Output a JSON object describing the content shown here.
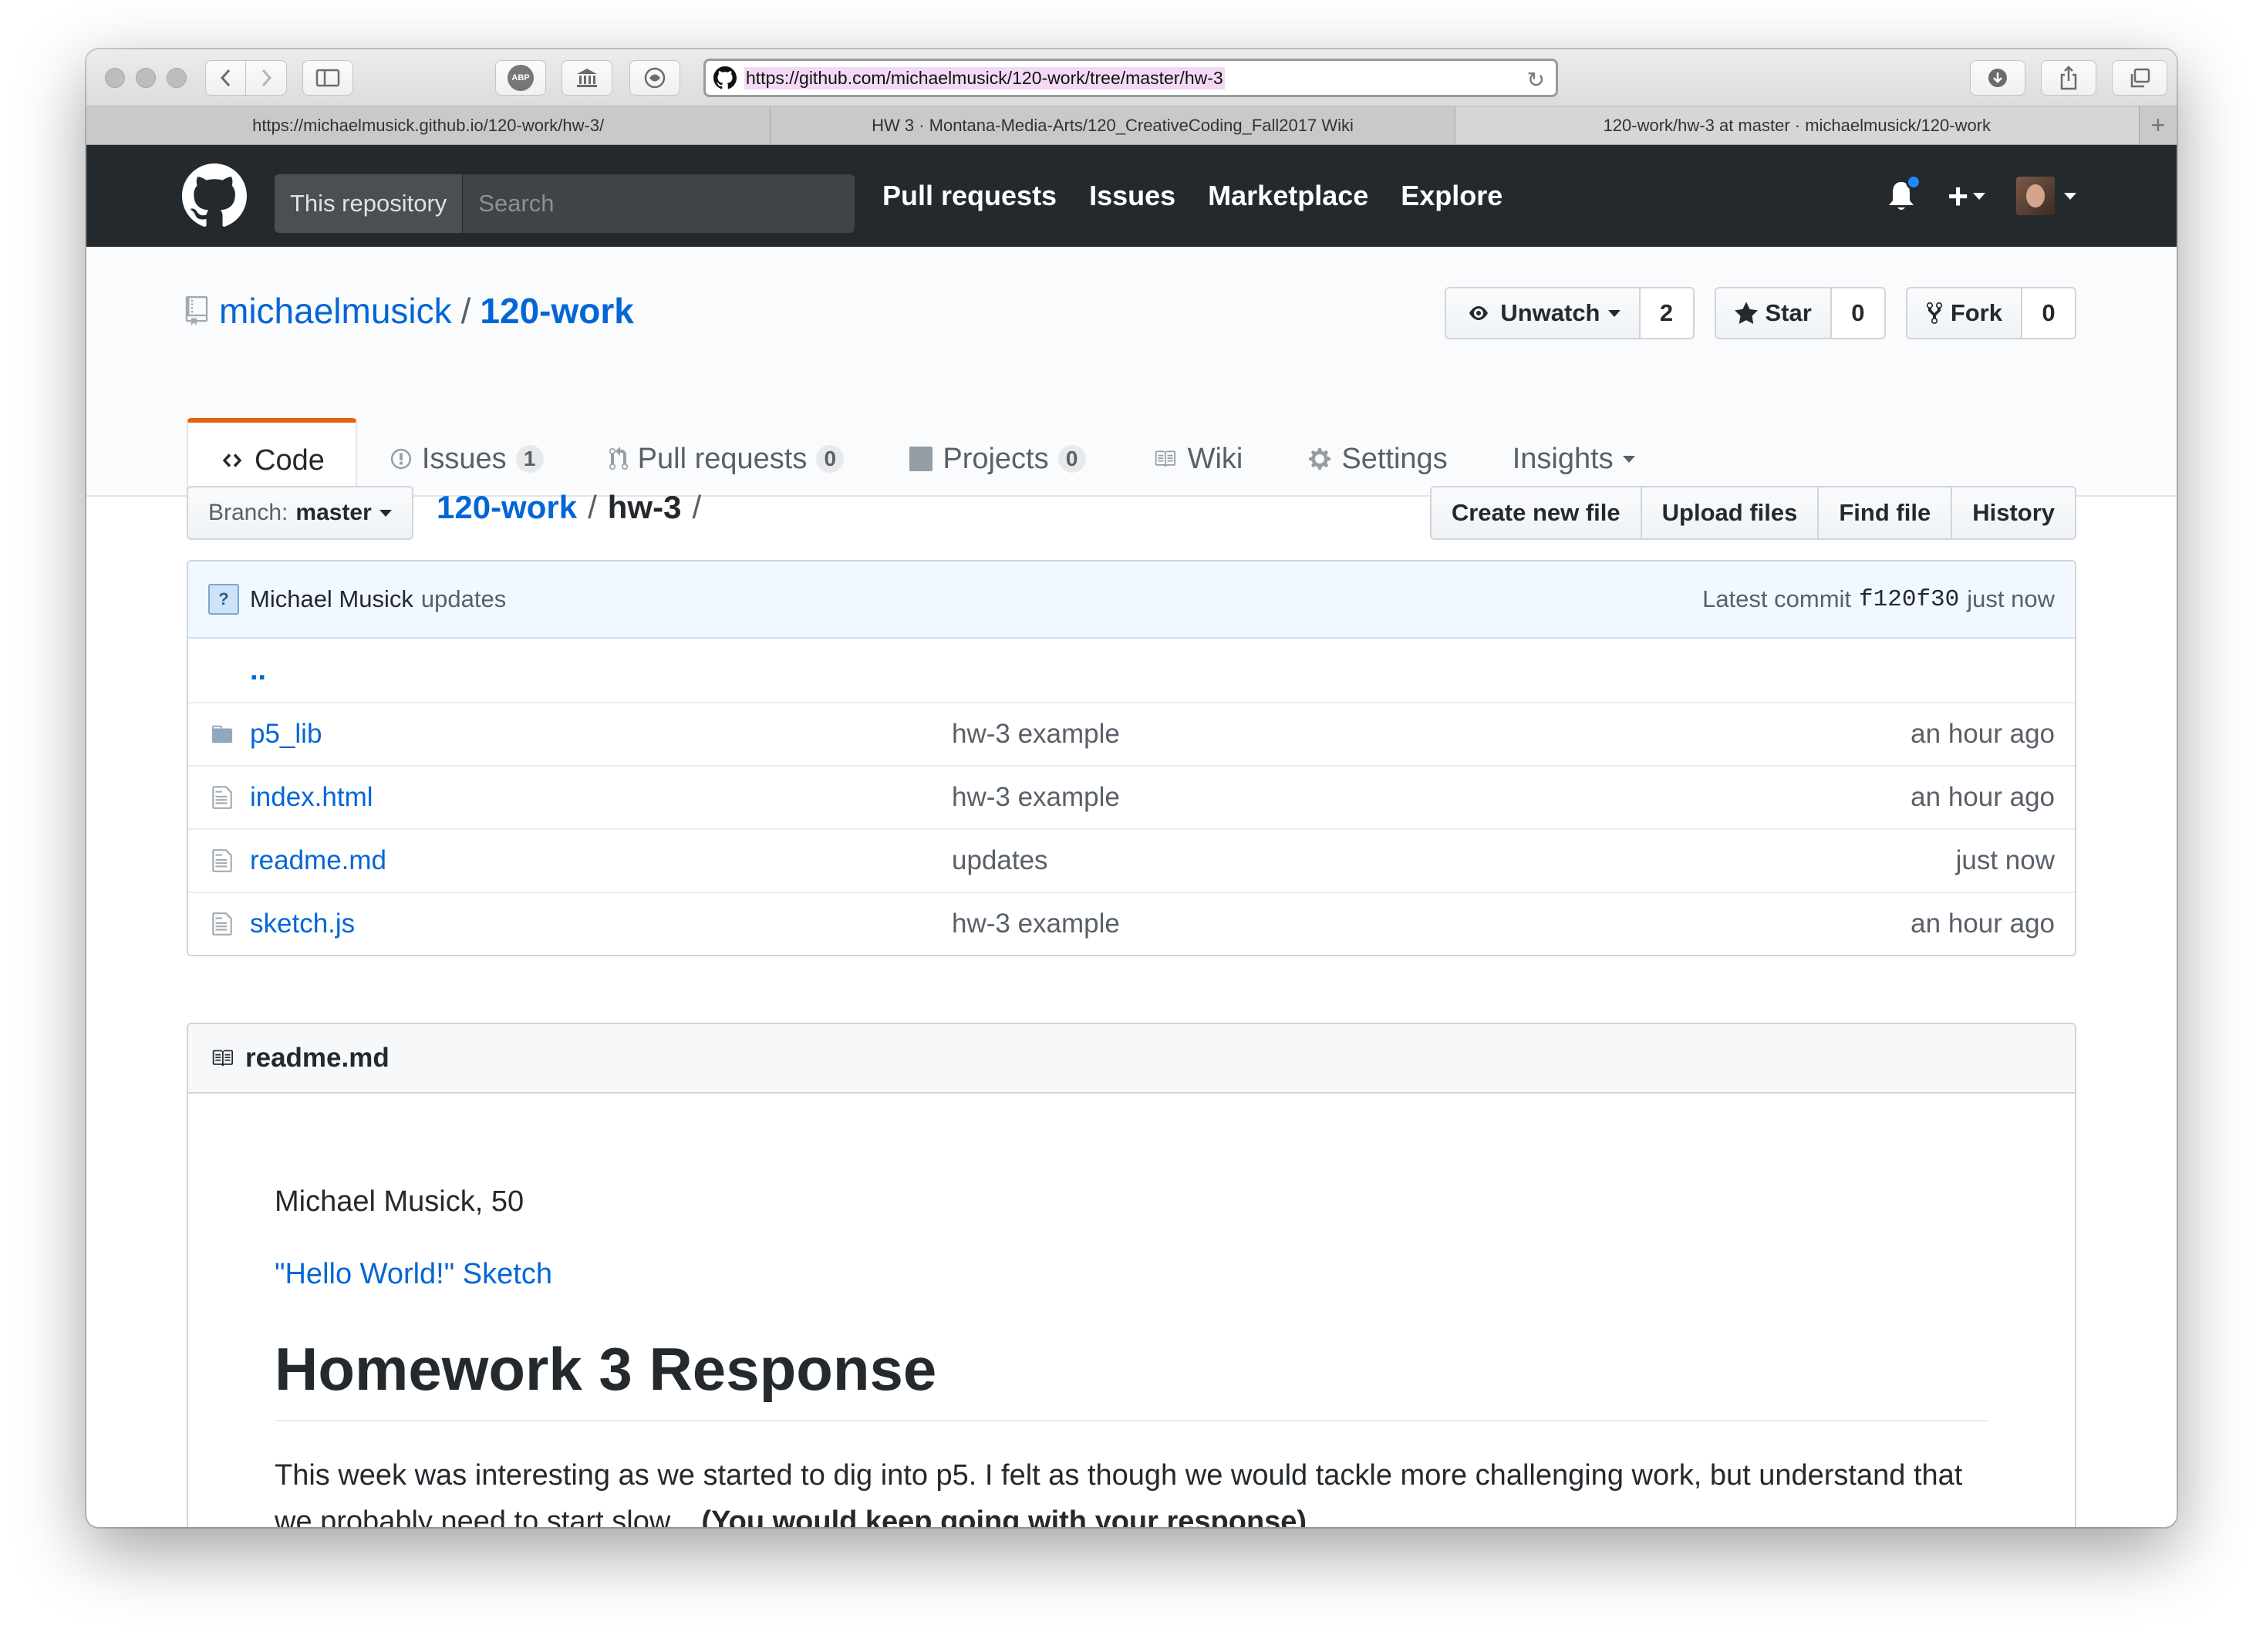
{
  "browser": {
    "url": "https://github.com/michaelmusick/120-work/tree/master/hw-3",
    "tabs": [
      {
        "title": "https://michaelmusick.github.io/120-work/hw-3/"
      },
      {
        "title": "HW 3 · Montana-Media-Arts/120_CreativeCoding_Fall2017 Wiki"
      },
      {
        "title": "120-work/hw-3 at master · michaelmusick/120-work"
      }
    ],
    "new_tab_label": "+",
    "toolbar_icons": [
      "back-icon",
      "forward-icon",
      "sidebar-icon",
      "abp-icon",
      "bank-icon",
      "privacy-icon",
      "download-icon",
      "share-icon",
      "tabs-icon"
    ],
    "abp_label": "ABP"
  },
  "header": {
    "search_scope": "This repository",
    "search_placeholder": "Search",
    "nav": [
      "Pull requests",
      "Issues",
      "Marketplace",
      "Explore"
    ],
    "plus_label": "+",
    "notification_color": "#2188ff"
  },
  "repo": {
    "owner": "michaelmusick",
    "separator": "/",
    "name": "120-work",
    "watch": {
      "label": "Unwatch",
      "count": "2"
    },
    "star": {
      "label": "Star",
      "count": "0"
    },
    "fork": {
      "label": "Fork",
      "count": "0"
    },
    "tabs": [
      {
        "label": "Code",
        "icon": "code-icon"
      },
      {
        "label": "Issues",
        "count": "1",
        "icon": "issue-icon"
      },
      {
        "label": "Pull requests",
        "count": "0",
        "icon": "pull-request-icon"
      },
      {
        "label": "Projects",
        "count": "0",
        "icon": "project-icon"
      },
      {
        "label": "Wiki",
        "icon": "book-icon"
      },
      {
        "label": "Settings",
        "icon": "gear-icon"
      },
      {
        "label": "Insights",
        "icon": "chevron-down-icon"
      }
    ]
  },
  "file_nav": {
    "branch_prefix": "Branch:",
    "branch": "master",
    "crumb_repo": "120-work",
    "crumb_sep1": "/",
    "crumb_dir": "hw-3",
    "crumb_sep2": "/",
    "actions": [
      "Create new file",
      "Upload files",
      "Find file",
      "History"
    ]
  },
  "commit": {
    "author": "Michael Musick",
    "message": "updates",
    "avatar_glyph": "?",
    "latest_label": "Latest commit",
    "sha": "f120f30",
    "time": "just now"
  },
  "files": {
    "updir": "..",
    "rows": [
      {
        "name": "p5_lib",
        "type": "folder",
        "message": "hw-3 example",
        "age": "an hour ago"
      },
      {
        "name": "index.html",
        "type": "file",
        "message": "hw-3 example",
        "age": "an hour ago"
      },
      {
        "name": "readme.md",
        "type": "file",
        "message": "updates",
        "age": "just now"
      },
      {
        "name": "sketch.js",
        "type": "file",
        "message": "hw-3 example",
        "age": "an hour ago"
      }
    ]
  },
  "readme": {
    "filename": "readme.md",
    "author_line": "Michael Musick, 50",
    "sketch_link": "\"Hello World!\" Sketch",
    "heading": "Homework 3 Response",
    "body": "This week was interesting as we started to dig into p5. I felt as though we would tackle more challenging work, but understand that we probably need to start slow...",
    "body_bold": "(You would keep going with your response)"
  }
}
